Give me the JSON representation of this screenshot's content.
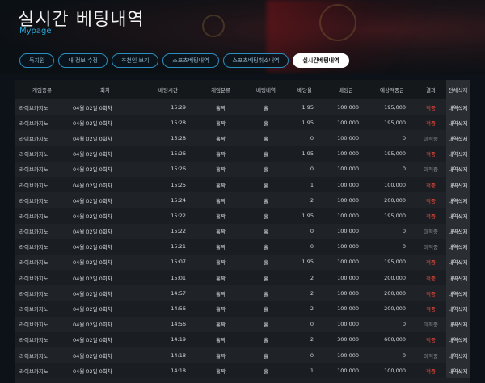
{
  "header": {
    "title": "실시간 베팅내역",
    "subtitle": "Mypage"
  },
  "tabs": [
    {
      "label": "독지원"
    },
    {
      "label": "내 정보 수정"
    },
    {
      "label": "추천인 보기"
    },
    {
      "label": "스포츠베팅내역"
    },
    {
      "label": "스포츠베팅취소내역"
    },
    {
      "label": "실시간베팅내역",
      "active": true
    }
  ],
  "table": {
    "headers": [
      "게임종류",
      "회차",
      "베팅시간",
      "게임분류",
      "베팅내역",
      "배당율",
      "베팅금",
      "예상적중금",
      "결과",
      "전체삭제"
    ],
    "rows": [
      {
        "type": "라이브카지노",
        "round": "04월 02일 0회차",
        "time": "15:29",
        "category": "홀짝",
        "bet": "홀",
        "odds": "1.95",
        "amount": "100,000",
        "expected": "195,000",
        "result": "적중",
        "result_status": "lose",
        "action": "내역삭제"
      },
      {
        "type": "라이브카지노",
        "round": "04월 02일 0회차",
        "time": "15:28",
        "category": "홀짝",
        "bet": "홀",
        "odds": "1.95",
        "amount": "100,000",
        "expected": "195,000",
        "result": "적중",
        "result_status": "lose",
        "action": "내역삭제"
      },
      {
        "type": "라이브카지노",
        "round": "04월 02일 0회차",
        "time": "15:28",
        "category": "홀짝",
        "bet": "홀",
        "odds": "0",
        "amount": "100,000",
        "expected": "0",
        "result": "미적중",
        "result_status": "pend",
        "action": "내역삭제"
      },
      {
        "type": "라이브카지노",
        "round": "04월 02일 0회차",
        "time": "15:26",
        "category": "홀짝",
        "bet": "홀",
        "odds": "1.95",
        "amount": "100,000",
        "expected": "195,000",
        "result": "적중",
        "result_status": "lose",
        "action": "내역삭제"
      },
      {
        "type": "라이브카지노",
        "round": "04월 02일 0회차",
        "time": "15:26",
        "category": "홀짝",
        "bet": "홀",
        "odds": "0",
        "amount": "100,000",
        "expected": "0",
        "result": "미적중",
        "result_status": "pend",
        "action": "내역삭제"
      },
      {
        "type": "라이브카지노",
        "round": "04월 02일 0회차",
        "time": "15:25",
        "category": "홀짝",
        "bet": "홀",
        "odds": "1",
        "amount": "100,000",
        "expected": "100,000",
        "result": "적중",
        "result_status": "lose",
        "action": "내역삭제"
      },
      {
        "type": "라이브카지노",
        "round": "04월 02일 0회차",
        "time": "15:24",
        "category": "홀짝",
        "bet": "홀",
        "odds": "2",
        "amount": "100,000",
        "expected": "200,000",
        "result": "적중",
        "result_status": "lose",
        "action": "내역삭제"
      },
      {
        "type": "라이브카지노",
        "round": "04월 02일 0회차",
        "time": "15:22",
        "category": "홀짝",
        "bet": "홀",
        "odds": "1.95",
        "amount": "100,000",
        "expected": "195,000",
        "result": "적중",
        "result_status": "lose",
        "action": "내역삭제"
      },
      {
        "type": "라이브카지노",
        "round": "04월 02일 0회차",
        "time": "15:22",
        "category": "홀짝",
        "bet": "홀",
        "odds": "0",
        "amount": "100,000",
        "expected": "0",
        "result": "미적중",
        "result_status": "pend",
        "action": "내역삭제"
      },
      {
        "type": "라이브카지노",
        "round": "04월 02일 0회차",
        "time": "15:21",
        "category": "홀짝",
        "bet": "홀",
        "odds": "0",
        "amount": "100,000",
        "expected": "0",
        "result": "미적중",
        "result_status": "pend",
        "action": "내역삭제"
      },
      {
        "type": "라이브카지노",
        "round": "04월 02일 0회차",
        "time": "15:07",
        "category": "홀짝",
        "bet": "홀",
        "odds": "1.95",
        "amount": "100,000",
        "expected": "195,000",
        "result": "적중",
        "result_status": "lose",
        "action": "내역삭제"
      },
      {
        "type": "라이브카지노",
        "round": "04월 02일 0회차",
        "time": "15:01",
        "category": "홀짝",
        "bet": "홀",
        "odds": "2",
        "amount": "100,000",
        "expected": "200,000",
        "result": "적중",
        "result_status": "lose",
        "action": "내역삭제"
      },
      {
        "type": "라이브카지노",
        "round": "04월 02일 0회차",
        "time": "14:57",
        "category": "홀짝",
        "bet": "홀",
        "odds": "2",
        "amount": "100,000",
        "expected": "200,000",
        "result": "적중",
        "result_status": "lose",
        "action": "내역삭제"
      },
      {
        "type": "라이브카지노",
        "round": "04월 02일 0회차",
        "time": "14:56",
        "category": "홀짝",
        "bet": "홀",
        "odds": "2",
        "amount": "100,000",
        "expected": "200,000",
        "result": "적중",
        "result_status": "lose",
        "action": "내역삭제"
      },
      {
        "type": "라이브카지노",
        "round": "04월 02일 0회차",
        "time": "14:56",
        "category": "홀짝",
        "bet": "홀",
        "odds": "0",
        "amount": "100,000",
        "expected": "0",
        "result": "미적중",
        "result_status": "pend",
        "action": "내역삭제"
      },
      {
        "type": "라이브카지노",
        "round": "04월 02일 0회차",
        "time": "14:19",
        "category": "홀짝",
        "bet": "홀",
        "odds": "2",
        "amount": "300,000",
        "expected": "600,000",
        "result": "적중",
        "result_status": "lose",
        "action": "내역삭제"
      },
      {
        "type": "라이브카지노",
        "round": "04월 02일 0회차",
        "time": "14:18",
        "category": "홀짝",
        "bet": "홀",
        "odds": "0",
        "amount": "100,000",
        "expected": "0",
        "result": "미적중",
        "result_status": "pend",
        "action": "내역삭제"
      },
      {
        "type": "라이브카지노",
        "round": "04월 02일 0회차",
        "time": "14:18",
        "category": "홀짝",
        "bet": "홀",
        "odds": "1",
        "amount": "100,000",
        "expected": "100,000",
        "result": "적중",
        "result_status": "lose",
        "action": "내역삭제"
      }
    ]
  },
  "colors": {
    "accent": "#2aa6d8",
    "hit": "#ff4a3d",
    "miss": "#8a8f94"
  }
}
